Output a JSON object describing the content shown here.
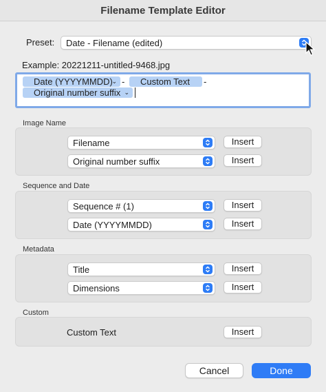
{
  "window": {
    "title": "Filename Template Editor"
  },
  "preset": {
    "label": "Preset:",
    "value": "Date - Filename (edited)"
  },
  "example": {
    "text": "Example: 20221211-untitled-9468.jpg"
  },
  "template": {
    "tokens": [
      "Date (YYYYMMDD)",
      "Custom Text",
      "Original number suffix"
    ],
    "separators": [
      "-",
      "-"
    ]
  },
  "sections": {
    "image_name": {
      "label": "Image Name",
      "fields": [
        "Filename",
        "Original number suffix"
      ]
    },
    "sequence_date": {
      "label": "Sequence and Date",
      "fields": [
        "Sequence # (1)",
        "Date (YYYYMMDD)"
      ]
    },
    "metadata": {
      "label": "Metadata",
      "fields": [
        "Title",
        "Dimensions"
      ]
    },
    "custom": {
      "label": "Custom",
      "item": "Custom Text"
    }
  },
  "insert_label": "Insert",
  "buttons": {
    "cancel": "Cancel",
    "done": "Done"
  },
  "icons": {
    "stepper": "up-down-chevron-icon",
    "token_menu": "chevron-down-icon",
    "pointer": "arrow-cursor-icon"
  },
  "colors": {
    "accent": "#2f7cf6",
    "token_bg": "#b7d2f5",
    "focus_ring": "#7fa9e8"
  }
}
